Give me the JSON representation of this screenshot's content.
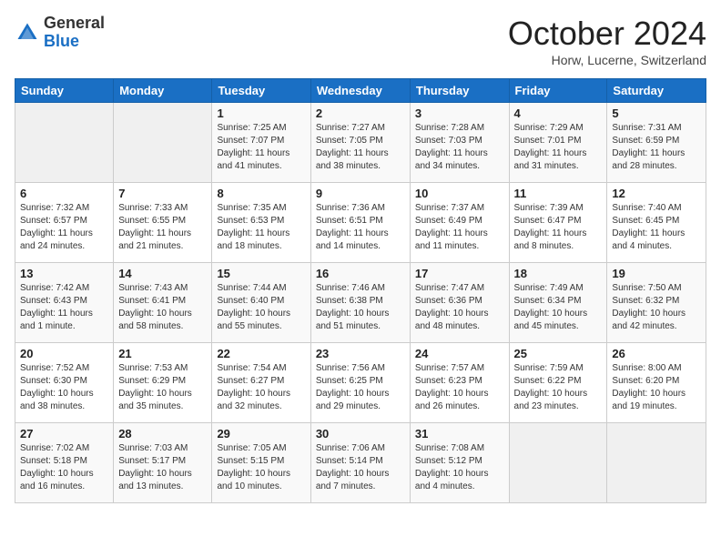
{
  "header": {
    "logo_general": "General",
    "logo_blue": "Blue",
    "month_title": "October 2024",
    "location": "Horw, Lucerne, Switzerland"
  },
  "weekdays": [
    "Sunday",
    "Monday",
    "Tuesday",
    "Wednesday",
    "Thursday",
    "Friday",
    "Saturday"
  ],
  "weeks": [
    [
      {
        "day": "",
        "info": ""
      },
      {
        "day": "",
        "info": ""
      },
      {
        "day": "1",
        "info": "Sunrise: 7:25 AM\nSunset: 7:07 PM\nDaylight: 11 hours and 41 minutes."
      },
      {
        "day": "2",
        "info": "Sunrise: 7:27 AM\nSunset: 7:05 PM\nDaylight: 11 hours and 38 minutes."
      },
      {
        "day": "3",
        "info": "Sunrise: 7:28 AM\nSunset: 7:03 PM\nDaylight: 11 hours and 34 minutes."
      },
      {
        "day": "4",
        "info": "Sunrise: 7:29 AM\nSunset: 7:01 PM\nDaylight: 11 hours and 31 minutes."
      },
      {
        "day": "5",
        "info": "Sunrise: 7:31 AM\nSunset: 6:59 PM\nDaylight: 11 hours and 28 minutes."
      }
    ],
    [
      {
        "day": "6",
        "info": "Sunrise: 7:32 AM\nSunset: 6:57 PM\nDaylight: 11 hours and 24 minutes."
      },
      {
        "day": "7",
        "info": "Sunrise: 7:33 AM\nSunset: 6:55 PM\nDaylight: 11 hours and 21 minutes."
      },
      {
        "day": "8",
        "info": "Sunrise: 7:35 AM\nSunset: 6:53 PM\nDaylight: 11 hours and 18 minutes."
      },
      {
        "day": "9",
        "info": "Sunrise: 7:36 AM\nSunset: 6:51 PM\nDaylight: 11 hours and 14 minutes."
      },
      {
        "day": "10",
        "info": "Sunrise: 7:37 AM\nSunset: 6:49 PM\nDaylight: 11 hours and 11 minutes."
      },
      {
        "day": "11",
        "info": "Sunrise: 7:39 AM\nSunset: 6:47 PM\nDaylight: 11 hours and 8 minutes."
      },
      {
        "day": "12",
        "info": "Sunrise: 7:40 AM\nSunset: 6:45 PM\nDaylight: 11 hours and 4 minutes."
      }
    ],
    [
      {
        "day": "13",
        "info": "Sunrise: 7:42 AM\nSunset: 6:43 PM\nDaylight: 11 hours and 1 minute."
      },
      {
        "day": "14",
        "info": "Sunrise: 7:43 AM\nSunset: 6:41 PM\nDaylight: 10 hours and 58 minutes."
      },
      {
        "day": "15",
        "info": "Sunrise: 7:44 AM\nSunset: 6:40 PM\nDaylight: 10 hours and 55 minutes."
      },
      {
        "day": "16",
        "info": "Sunrise: 7:46 AM\nSunset: 6:38 PM\nDaylight: 10 hours and 51 minutes."
      },
      {
        "day": "17",
        "info": "Sunrise: 7:47 AM\nSunset: 6:36 PM\nDaylight: 10 hours and 48 minutes."
      },
      {
        "day": "18",
        "info": "Sunrise: 7:49 AM\nSunset: 6:34 PM\nDaylight: 10 hours and 45 minutes."
      },
      {
        "day": "19",
        "info": "Sunrise: 7:50 AM\nSunset: 6:32 PM\nDaylight: 10 hours and 42 minutes."
      }
    ],
    [
      {
        "day": "20",
        "info": "Sunrise: 7:52 AM\nSunset: 6:30 PM\nDaylight: 10 hours and 38 minutes."
      },
      {
        "day": "21",
        "info": "Sunrise: 7:53 AM\nSunset: 6:29 PM\nDaylight: 10 hours and 35 minutes."
      },
      {
        "day": "22",
        "info": "Sunrise: 7:54 AM\nSunset: 6:27 PM\nDaylight: 10 hours and 32 minutes."
      },
      {
        "day": "23",
        "info": "Sunrise: 7:56 AM\nSunset: 6:25 PM\nDaylight: 10 hours and 29 minutes."
      },
      {
        "day": "24",
        "info": "Sunrise: 7:57 AM\nSunset: 6:23 PM\nDaylight: 10 hours and 26 minutes."
      },
      {
        "day": "25",
        "info": "Sunrise: 7:59 AM\nSunset: 6:22 PM\nDaylight: 10 hours and 23 minutes."
      },
      {
        "day": "26",
        "info": "Sunrise: 8:00 AM\nSunset: 6:20 PM\nDaylight: 10 hours and 19 minutes."
      }
    ],
    [
      {
        "day": "27",
        "info": "Sunrise: 7:02 AM\nSunset: 5:18 PM\nDaylight: 10 hours and 16 minutes."
      },
      {
        "day": "28",
        "info": "Sunrise: 7:03 AM\nSunset: 5:17 PM\nDaylight: 10 hours and 13 minutes."
      },
      {
        "day": "29",
        "info": "Sunrise: 7:05 AM\nSunset: 5:15 PM\nDaylight: 10 hours and 10 minutes."
      },
      {
        "day": "30",
        "info": "Sunrise: 7:06 AM\nSunset: 5:14 PM\nDaylight: 10 hours and 7 minutes."
      },
      {
        "day": "31",
        "info": "Sunrise: 7:08 AM\nSunset: 5:12 PM\nDaylight: 10 hours and 4 minutes."
      },
      {
        "day": "",
        "info": ""
      },
      {
        "day": "",
        "info": ""
      }
    ]
  ]
}
